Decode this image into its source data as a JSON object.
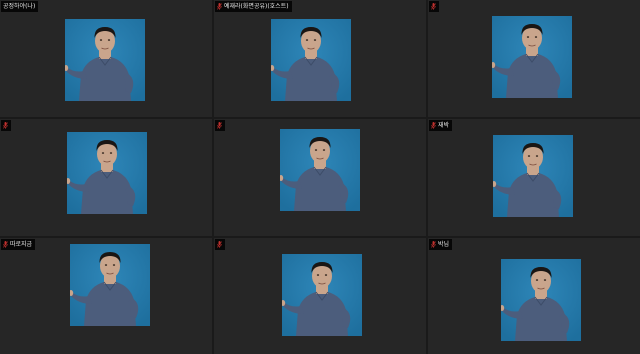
{
  "colors": {
    "background": "#1a1a1a",
    "tile": "#262626",
    "muted_mic": "#c0302e",
    "video_bg": "#1e6f9e",
    "shirt": "#4c5d7c",
    "skin": "#c9a58c",
    "hair": "#1a1614"
  },
  "participants": [
    {
      "name": "공정하야(나)",
      "mic": "none",
      "avatar": "person-video"
    },
    {
      "name": "예재라(화면공유)(호스트)",
      "mic": "muted-mic-icon",
      "avatar": "person-video"
    },
    {
      "name": "",
      "mic": "muted-mic-icon",
      "avatar": "person-video"
    },
    {
      "name": "",
      "mic": "muted-mic-icon",
      "avatar": "person-video"
    },
    {
      "name": "",
      "mic": "muted-mic-icon",
      "avatar": "person-video"
    },
    {
      "name": "재박",
      "mic": "muted-mic-icon",
      "avatar": "person-video"
    },
    {
      "name": "따로지금",
      "mic": "muted-mic-icon",
      "avatar": "person-video"
    },
    {
      "name": "",
      "mic": "muted-mic-icon",
      "avatar": "person-video"
    },
    {
      "name": "박님",
      "mic": "muted-mic-icon",
      "avatar": "person-video"
    }
  ]
}
